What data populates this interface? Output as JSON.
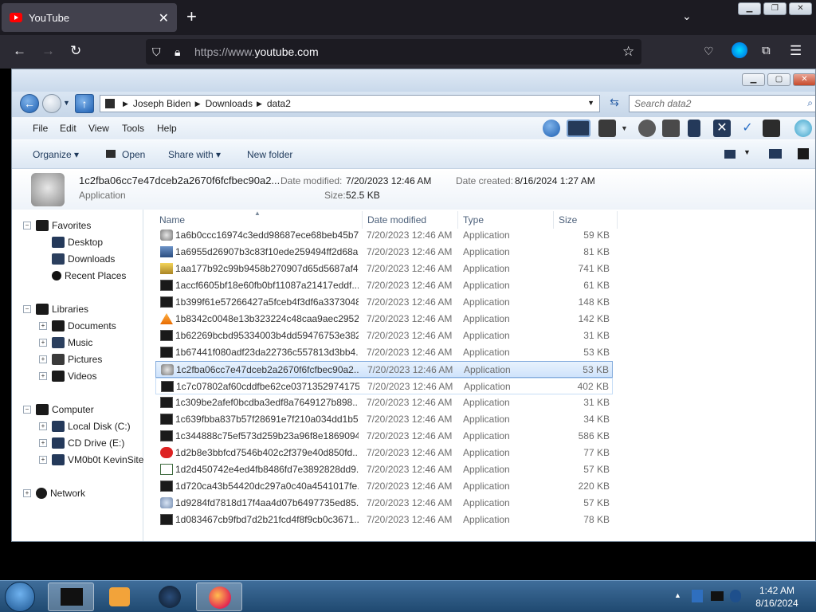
{
  "browser": {
    "tab_title": "YouTube",
    "url_prefix": "https://www.",
    "url_domain": "youtube.com"
  },
  "explorer": {
    "breadcrumb": [
      "Joseph Biden",
      "Downloads",
      "data2"
    ],
    "search_placeholder": "Search data2",
    "menu": [
      "File",
      "Edit",
      "View",
      "Tools",
      "Help"
    ],
    "commands": {
      "organize": "Organize",
      "open": "Open",
      "share_with": "Share with",
      "new_folder": "New folder"
    },
    "details": {
      "name": "1c2fba06cc7e47dceb2a2670f6fcfbec90a2...",
      "type": "Application",
      "date_modified_label": "Date modified:",
      "date_modified": "7/20/2023 12:46 AM",
      "date_created_label": "Date created:",
      "date_created": "8/16/2024 1:27 AM",
      "size_label": "Size:",
      "size": "52.5 KB"
    },
    "nav": {
      "favorites": "Favorites",
      "desktop": "Desktop",
      "downloads": "Downloads",
      "recent": "Recent Places",
      "libraries": "Libraries",
      "documents": "Documents",
      "music": "Music",
      "pictures": "Pictures",
      "videos": "Videos",
      "computer": "Computer",
      "local_disk": "Local Disk (C:)",
      "cd_drive": "CD Drive (E:)",
      "vmshare": "VM0b0t KevinSite",
      "network": "Network"
    },
    "columns": {
      "name": "Name",
      "date": "Date modified",
      "type": "Type",
      "size": "Size"
    },
    "files": [
      {
        "name": "1a6b0ccc16974c3edd98687ece68beb45b7...",
        "date": "7/20/2023 12:46 AM",
        "type": "Application",
        "size": "59 KB",
        "icon": "gear-doc"
      },
      {
        "name": "1a6955d26907b3c83f10ede259494ff2d68a...",
        "date": "7/20/2023 12:46 AM",
        "type": "Application",
        "size": "81 KB",
        "icon": "setup"
      },
      {
        "name": "1aa177b92c99b9458b270907d65d5687af4...",
        "date": "7/20/2023 12:46 AM",
        "type": "Application",
        "size": "741 KB",
        "icon": "pen"
      },
      {
        "name": "1accf6605bf18e60fb0bf11087a21417eddf...",
        "date": "7/20/2023 12:46 AM",
        "type": "Application",
        "size": "61 KB",
        "icon": "console"
      },
      {
        "name": "1b399f61e57266427a5fceb4f3df6a3373048...",
        "date": "7/20/2023 12:46 AM",
        "type": "Application",
        "size": "148 KB",
        "icon": "console"
      },
      {
        "name": "1b8342c0048e13b323224c48caa9aec2952f...",
        "date": "7/20/2023 12:46 AM",
        "type": "Application",
        "size": "142 KB",
        "icon": "vlc"
      },
      {
        "name": "1b62269bcbd95334003b4dd59476753e382...",
        "date": "7/20/2023 12:46 AM",
        "type": "Application",
        "size": "31 KB",
        "icon": "console"
      },
      {
        "name": "1b67441f080adf23da22736c557813d3bb4...",
        "date": "7/20/2023 12:46 AM",
        "type": "Application",
        "size": "53 KB",
        "icon": "console"
      },
      {
        "name": "1c2fba06cc7e47dceb2a2670f6fcfbec90a2...",
        "date": "7/20/2023 12:46 AM",
        "type": "Application",
        "size": "53 KB",
        "icon": "gear-doc"
      },
      {
        "name": "1c7c07802af60cddfbe62ce0371352974175...",
        "date": "7/20/2023 12:46 AM",
        "type": "Application",
        "size": "402 KB",
        "icon": "console"
      },
      {
        "name": "1c309be2afef0bcdba3edf8a7649127b898...",
        "date": "7/20/2023 12:46 AM",
        "type": "Application",
        "size": "31 KB",
        "icon": "console"
      },
      {
        "name": "1c639fbba837b57f28691e7f210a034dd1b5...",
        "date": "7/20/2023 12:46 AM",
        "type": "Application",
        "size": "34 KB",
        "icon": "console"
      },
      {
        "name": "1c344888c75ef573d259b23a96f8e1869094...",
        "date": "7/20/2023 12:46 AM",
        "type": "Application",
        "size": "586 KB",
        "icon": "console"
      },
      {
        "name": "1d2b8e3bbfcd7546b402c2f379e40d850fd...",
        "date": "7/20/2023 12:46 AM",
        "type": "Application",
        "size": "77 KB",
        "icon": "error"
      },
      {
        "name": "1d2d450742e4ed4fb8486fd7e3892828dd9...",
        "date": "7/20/2023 12:46 AM",
        "type": "Application",
        "size": "57 KB",
        "icon": "window"
      },
      {
        "name": "1d720ca43b54420dc297a0c40a4541017fe...",
        "date": "7/20/2023 12:46 AM",
        "type": "Application",
        "size": "220 KB",
        "icon": "console"
      },
      {
        "name": "1d9284fd7818d17f4aa4d07b6497735ed85...",
        "date": "7/20/2023 12:46 AM",
        "type": "Application",
        "size": "57 KB",
        "icon": "setup-disc"
      },
      {
        "name": "1d083467cb9fbd7d2b21fcd4f8f9cb0c3671...",
        "date": "7/20/2023 12:46 AM",
        "type": "Application",
        "size": "78 KB",
        "icon": "console"
      }
    ]
  },
  "taskbar": {
    "time": "1:42 AM",
    "date": "8/16/2024"
  }
}
